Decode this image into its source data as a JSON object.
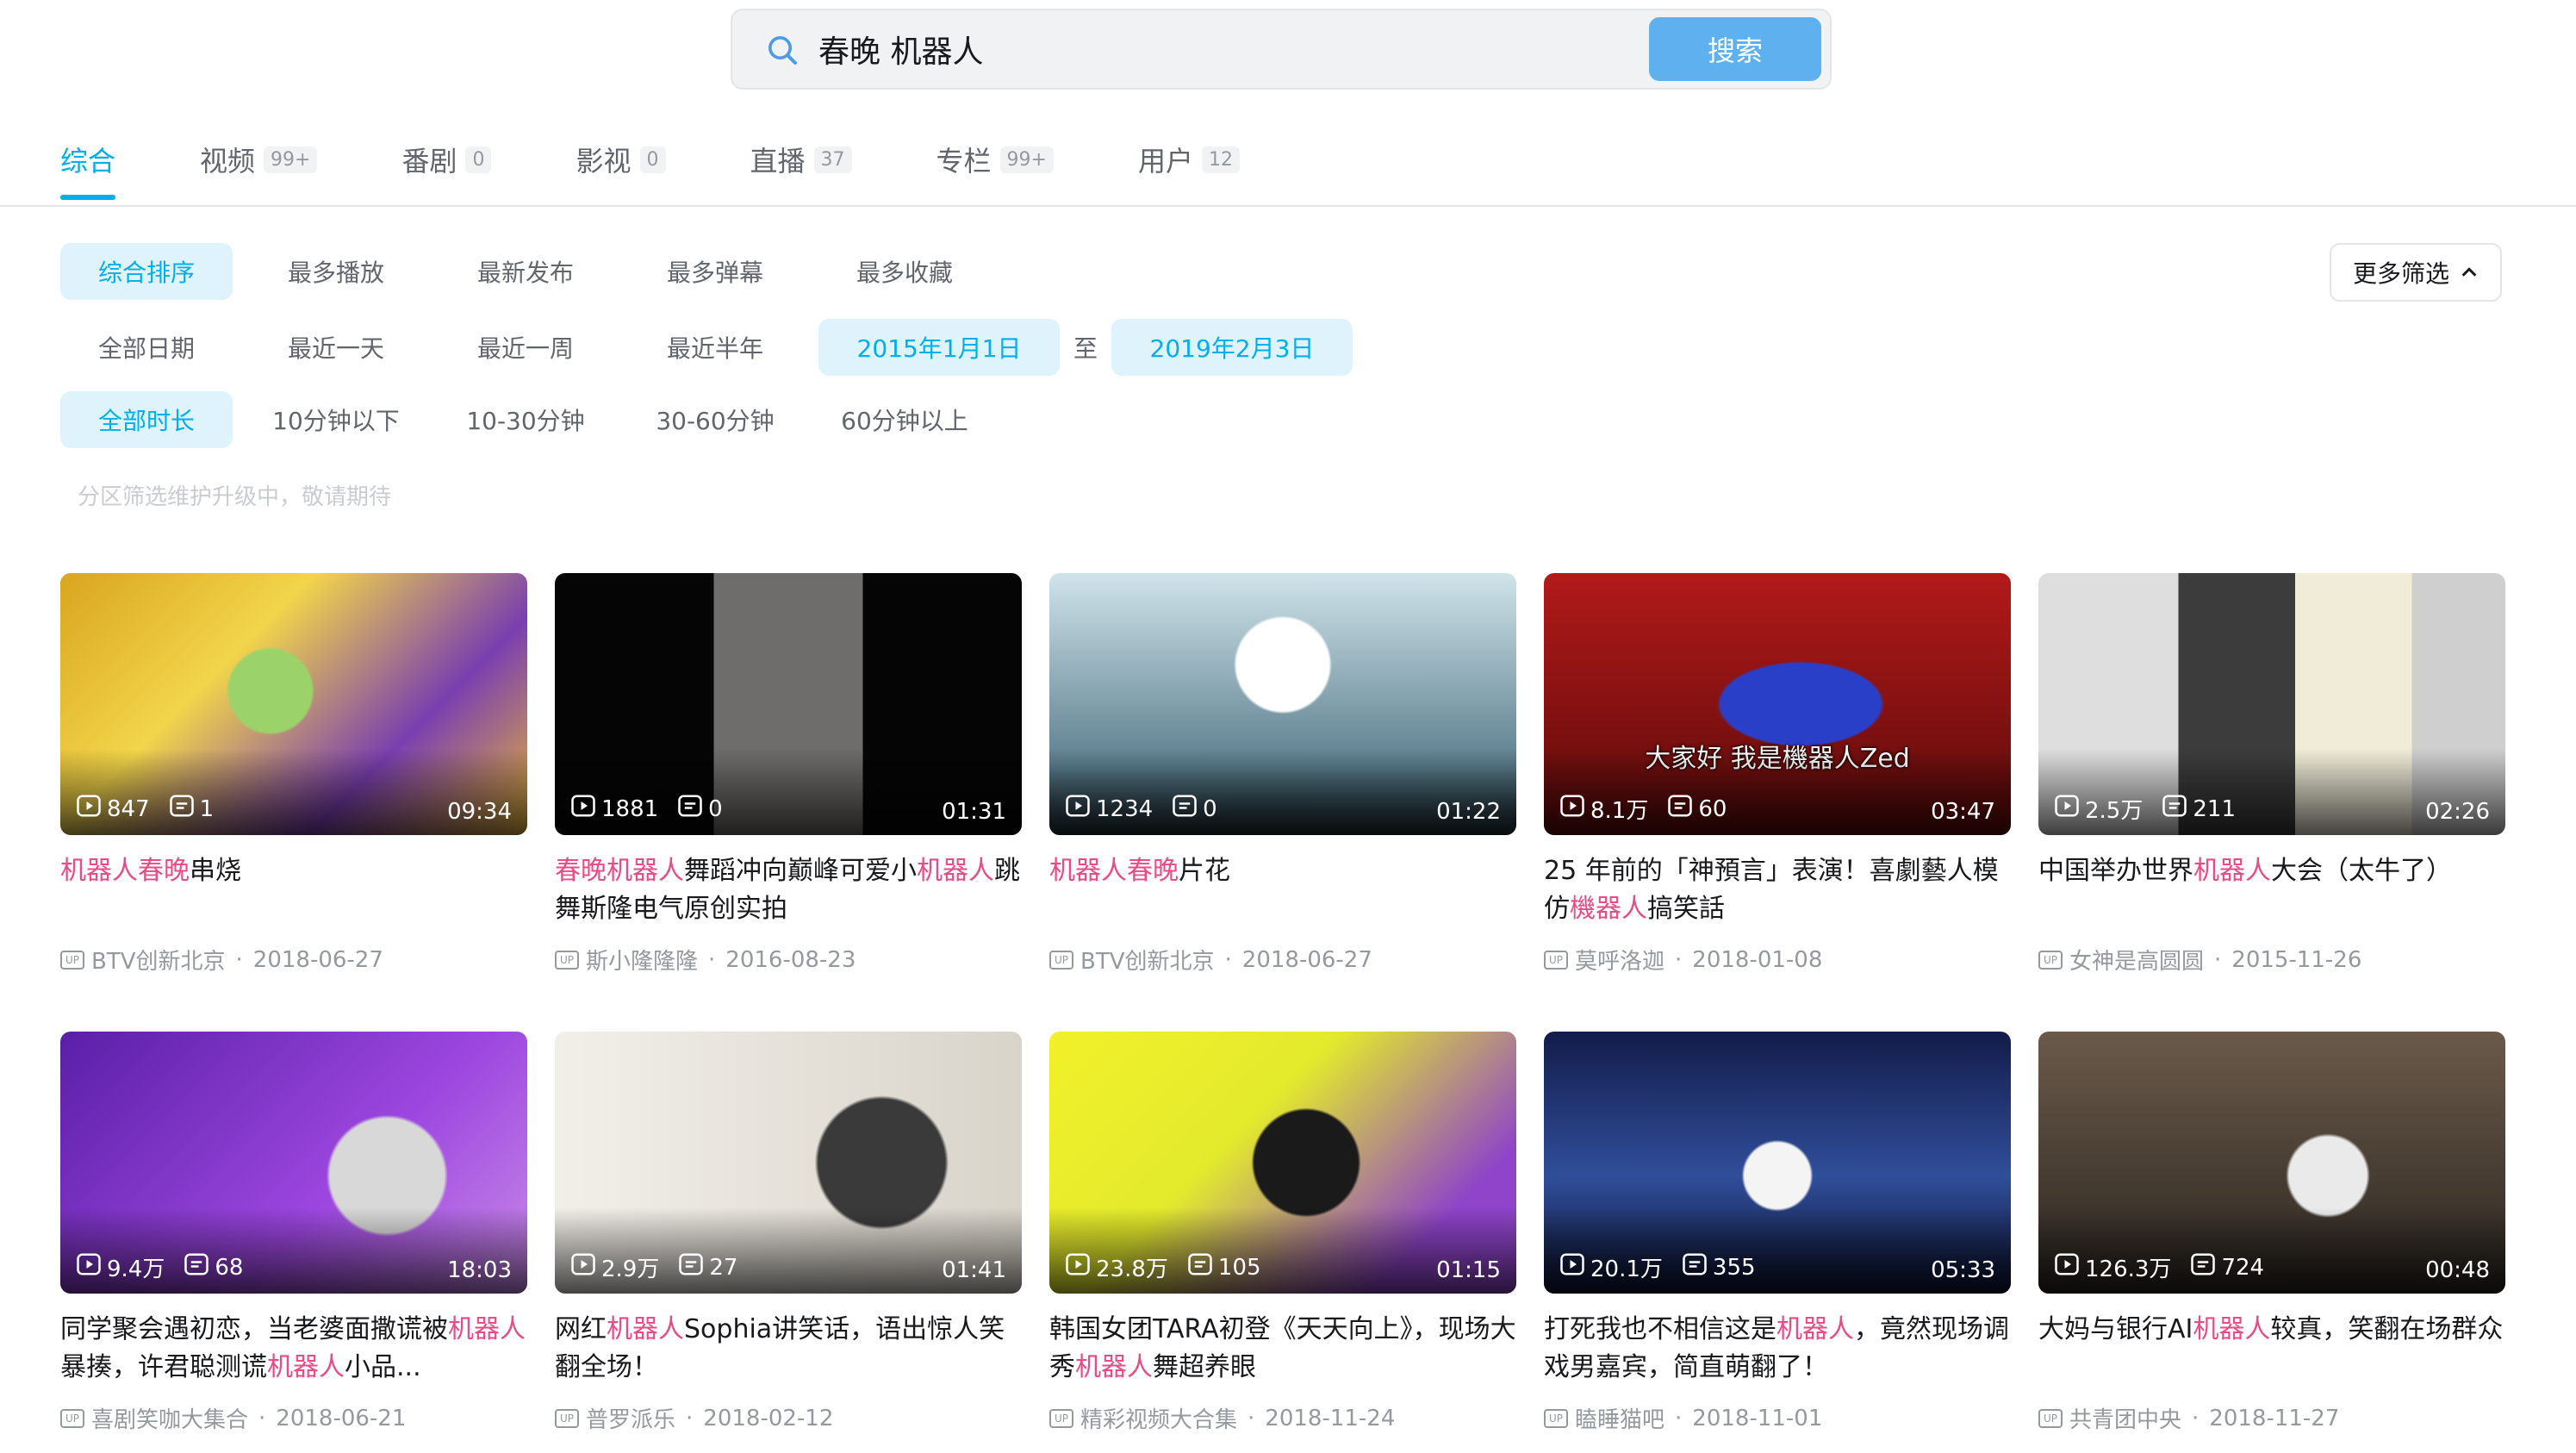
{
  "search": {
    "query": "春晚 机器人",
    "button_label": "搜索"
  },
  "tabs": [
    {
      "label": "综合",
      "count": ""
    },
    {
      "label": "视频",
      "count": "99+"
    },
    {
      "label": "番剧",
      "count": "0"
    },
    {
      "label": "影视",
      "count": "0"
    },
    {
      "label": "直播",
      "count": "37"
    },
    {
      "label": "专栏",
      "count": "99+"
    },
    {
      "label": "用户",
      "count": "12"
    }
  ],
  "filters": {
    "sort": [
      "综合排序",
      "最多播放",
      "最新发布",
      "最多弹幕",
      "最多收藏"
    ],
    "date": [
      "全部日期",
      "最近一天",
      "最近一周",
      "最近半年"
    ],
    "date_from": "2015年1月1日",
    "date_sep": "至",
    "date_to": "2019年2月3日",
    "duration": [
      "全部时长",
      "10分钟以下",
      "10-30分钟",
      "30-60分钟",
      "60分钟以上"
    ],
    "more_label": "更多筛选",
    "notice": "分区筛选维护升级中，敬请期待"
  },
  "videos": [
    {
      "title_parts": [
        [
          "机器人",
          true
        ],
        [
          "春晚",
          true
        ],
        [
          "串烧",
          false
        ]
      ],
      "views": "847",
      "danmaku": "1",
      "duration": "09:34",
      "up": "BTV创新北京",
      "date": "2018-06-27",
      "caption": ""
    },
    {
      "title_parts": [
        [
          "春晚",
          true
        ],
        [
          "机器人",
          true
        ],
        [
          "舞蹈冲向巅峰可爱小",
          false
        ],
        [
          "机器人",
          true
        ],
        [
          "跳舞斯隆电气原创实拍",
          false
        ]
      ],
      "views": "1881",
      "danmaku": "0",
      "duration": "01:31",
      "up": "斯小隆隆隆",
      "date": "2016-08-23",
      "caption": ""
    },
    {
      "title_parts": [
        [
          "机器人",
          true
        ],
        [
          "春晚",
          true
        ],
        [
          "片花",
          false
        ]
      ],
      "views": "1234",
      "danmaku": "0",
      "duration": "01:22",
      "up": "BTV创新北京",
      "date": "2018-06-27",
      "caption": ""
    },
    {
      "title_parts": [
        [
          "25 年前的「神預言」表演！喜劇藝人模仿",
          false
        ],
        [
          "機器人",
          true
        ],
        [
          "搞笑話",
          false
        ]
      ],
      "views": "8.1万",
      "danmaku": "60",
      "duration": "03:47",
      "up": "莫呼洛迦",
      "date": "2018-01-08",
      "caption": "大家好 我是機器人Zed"
    },
    {
      "title_parts": [
        [
          "中国举办世界",
          false
        ],
        [
          "机器人",
          true
        ],
        [
          "大会（太牛了）",
          false
        ]
      ],
      "views": "2.5万",
      "danmaku": "211",
      "duration": "02:26",
      "up": "女神是高圆圆",
      "date": "2015-11-26",
      "caption": ""
    },
    {
      "title_parts": [
        [
          "同学聚会遇初恋，当老婆面撒谎被",
          false
        ],
        [
          "机器人",
          true
        ],
        [
          "暴揍，许君聪测谎",
          false
        ],
        [
          "机器人",
          true
        ],
        [
          "小品...",
          false
        ]
      ],
      "views": "9.4万",
      "danmaku": "68",
      "duration": "18:03",
      "up": "喜剧笑咖大集合",
      "date": "2018-06-21",
      "caption": ""
    },
    {
      "title_parts": [
        [
          "网红",
          false
        ],
        [
          "机器人",
          true
        ],
        [
          "Sophia讲笑话，语出惊人笑翻全场！",
          false
        ]
      ],
      "views": "2.9万",
      "danmaku": "27",
      "duration": "01:41",
      "up": "普罗派乐",
      "date": "2018-02-12",
      "caption": ""
    },
    {
      "title_parts": [
        [
          "韩国女团TARA初登《天天向上》，现场大秀",
          false
        ],
        [
          "机器人",
          true
        ],
        [
          "舞超养眼",
          false
        ]
      ],
      "views": "23.8万",
      "danmaku": "105",
      "duration": "01:15",
      "up": "精彩视频大合集",
      "date": "2018-11-24",
      "caption": ""
    },
    {
      "title_parts": [
        [
          "打死我也不相信这是",
          false
        ],
        [
          "机器人",
          true
        ],
        [
          "，竟然现场调戏男嘉宾，简直萌翻了！",
          false
        ]
      ],
      "views": "20.1万",
      "danmaku": "355",
      "duration": "05:33",
      "up": "瞌睡猫吧",
      "date": "2018-11-01",
      "caption": ""
    },
    {
      "title_parts": [
        [
          "大妈与银行AI",
          false
        ],
        [
          "机器人",
          true
        ],
        [
          "较真，笑翻在场群众",
          false
        ]
      ],
      "views": "126.3万",
      "danmaku": "724",
      "duration": "00:48",
      "up": "共青团中央",
      "date": "2018-11-27",
      "caption": ""
    }
  ],
  "colors": {
    "accent": "#00aeec",
    "highlight": "#e84b85",
    "search_button": "#5fb0ef"
  }
}
